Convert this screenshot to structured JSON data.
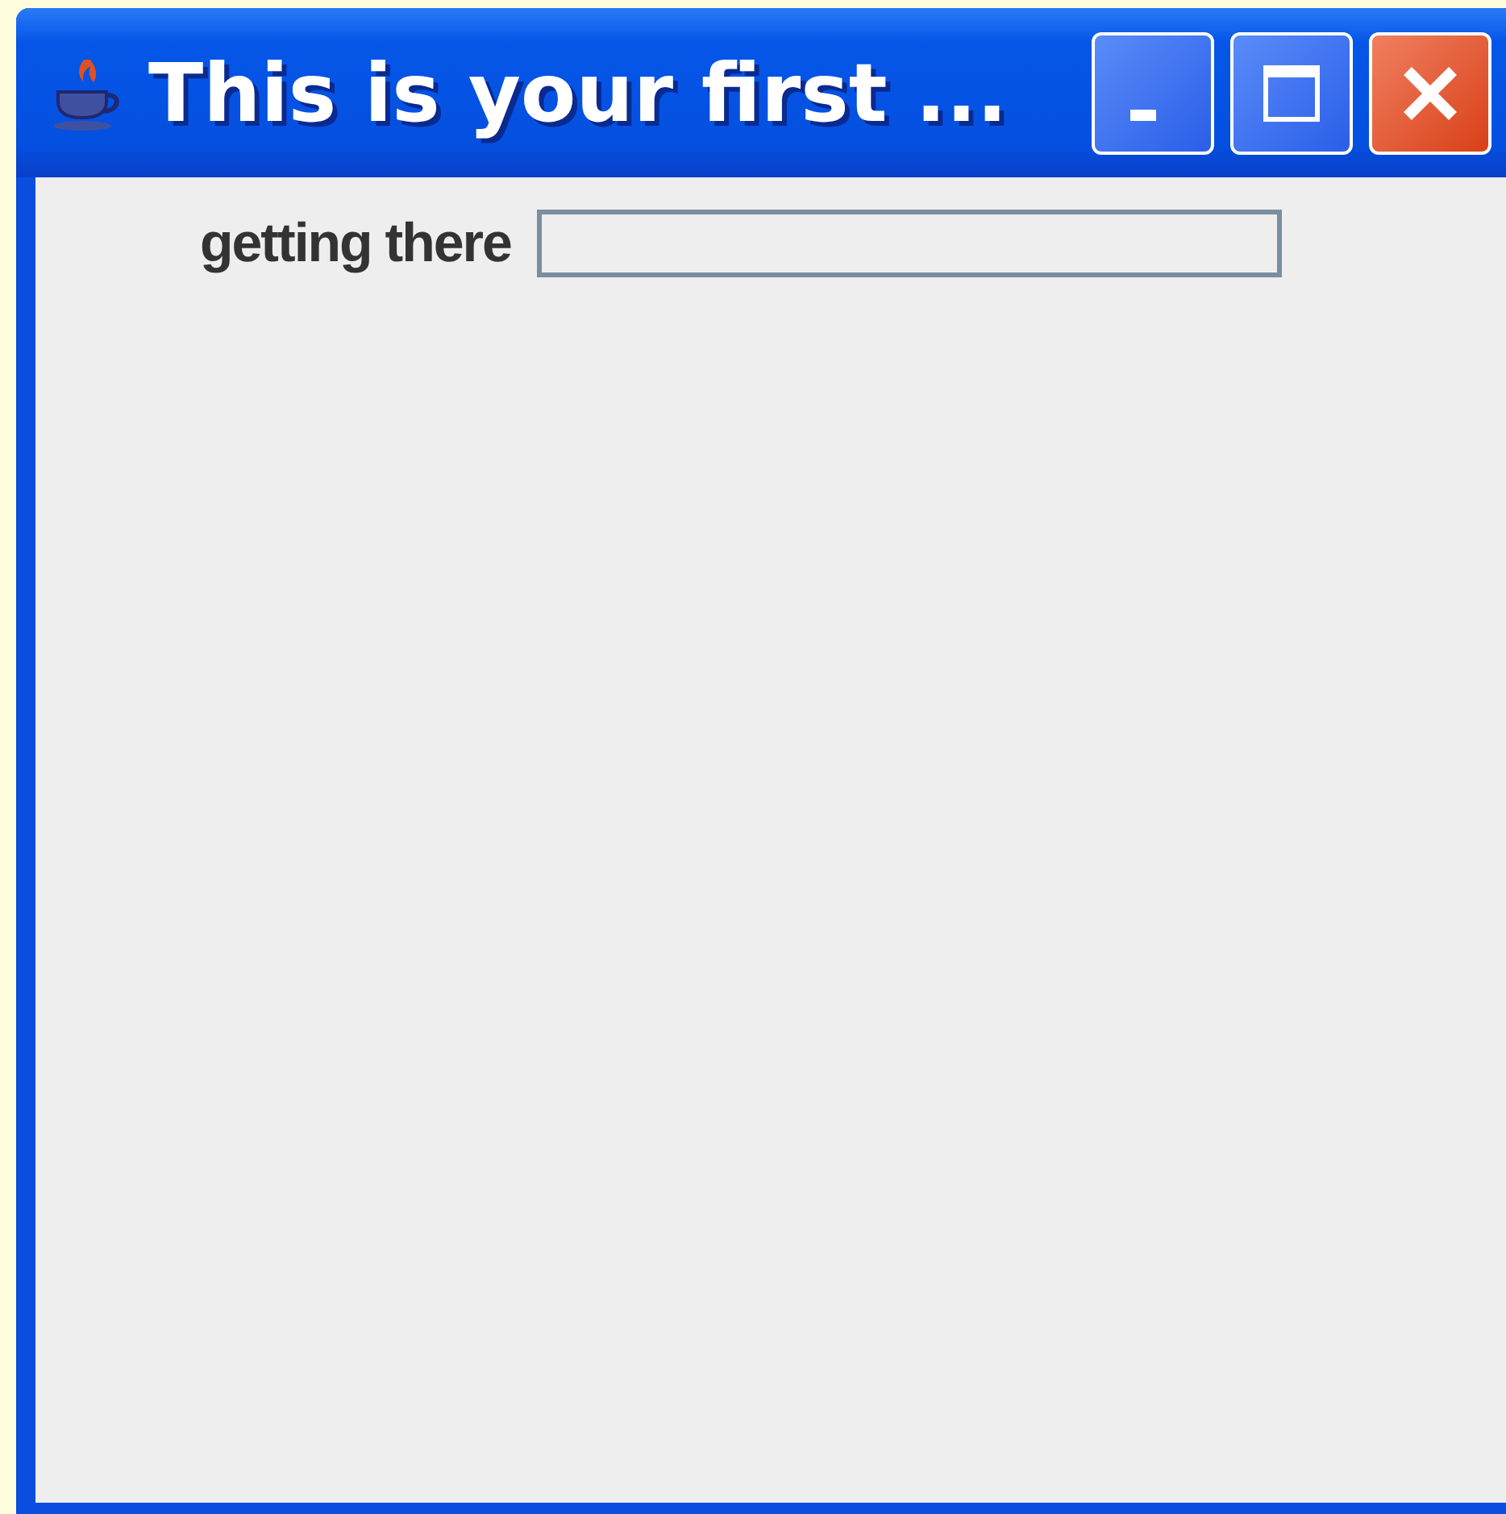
{
  "window": {
    "title": "This is your first ..."
  },
  "form": {
    "label": "getting there"
  }
}
